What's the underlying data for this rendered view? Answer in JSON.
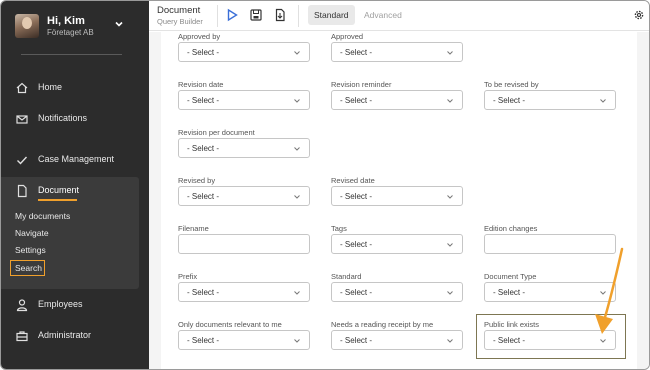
{
  "sidebar": {
    "user": {
      "greeting": "Hi, Kim",
      "company": "Företaget AB"
    },
    "nav": [
      {
        "label": "Home",
        "icon": "home-icon"
      },
      {
        "label": "Notifications",
        "icon": "envelope-icon"
      },
      {
        "label": "Case Management",
        "icon": "check-icon"
      },
      {
        "label": "Document",
        "icon": "file-icon"
      },
      {
        "label": "Employees",
        "icon": "person-icon"
      },
      {
        "label": "Administrator",
        "icon": "briefcase-icon"
      }
    ],
    "document_sub": [
      "My documents",
      "Navigate",
      "Settings",
      "Search"
    ]
  },
  "topbar": {
    "title": "Document",
    "subtitle": "Query Builder",
    "modes": {
      "standard": "Standard",
      "advanced": "Advanced"
    }
  },
  "form": {
    "select_placeholder": "- Select -",
    "fields": {
      "approved_by": "Approved by",
      "approved": "Approved",
      "revision_date": "Revision date",
      "revision_reminder": "Revision reminder",
      "to_be_revised_by": "To be revised by",
      "revision_per_document": "Revision per document",
      "revised_by": "Revised by",
      "revised_date": "Revised date",
      "filename": "Filename",
      "tags": "Tags",
      "edition_changes": "Edition changes",
      "prefix": "Prefix",
      "standard": "Standard",
      "document_type": "Document Type",
      "only_relevant": "Only documents relevant to me",
      "reading_receipt": "Needs a reading receipt by me",
      "public_link": "Public link exists"
    }
  },
  "colors": {
    "sidebar_bg": "#2c2c2c",
    "accent": "#f0a02c",
    "play_icon": "#3b6fd8"
  }
}
